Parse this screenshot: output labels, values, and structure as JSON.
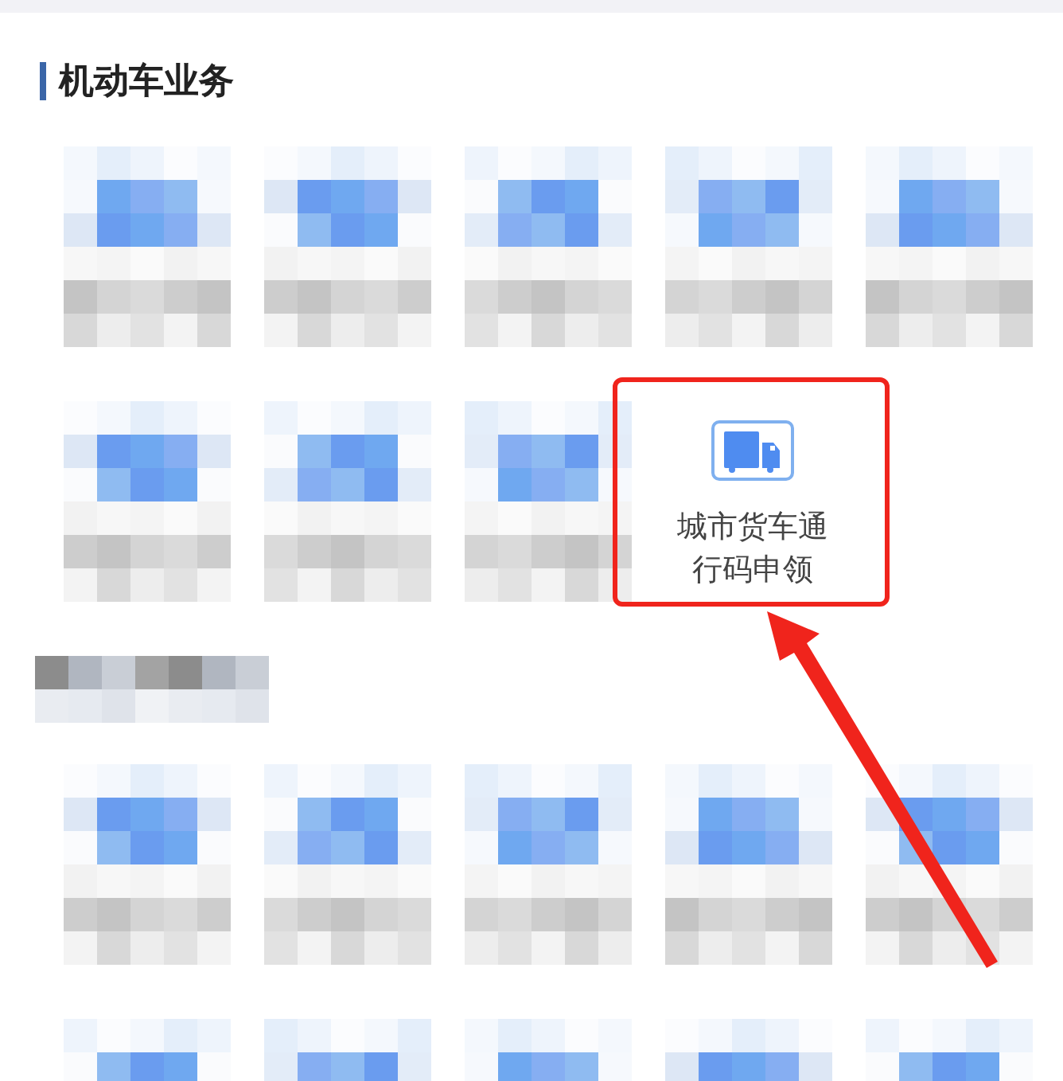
{
  "section": {
    "title": "机动车业务"
  },
  "groups": [
    {
      "items": [
        {
          "kind": "blurred"
        },
        {
          "kind": "blurred"
        },
        {
          "kind": "blurred"
        },
        {
          "kind": "blurred"
        },
        {
          "kind": "blurred"
        },
        {
          "kind": "blurred"
        },
        {
          "kind": "blurred"
        },
        {
          "kind": "blurred"
        },
        {
          "kind": "service",
          "label": "城市货车通行码申领",
          "highlighted": true
        }
      ]
    },
    {
      "heading": {
        "kind": "blurred"
      },
      "items": [
        {
          "kind": "blurred"
        },
        {
          "kind": "blurred"
        },
        {
          "kind": "blurred"
        },
        {
          "kind": "blurred"
        },
        {
          "kind": "blurred"
        },
        {
          "kind": "blurred"
        },
        {
          "kind": "blurred"
        },
        {
          "kind": "blurred"
        },
        {
          "kind": "blurred"
        },
        {
          "kind": "blurred"
        }
      ]
    }
  ]
}
